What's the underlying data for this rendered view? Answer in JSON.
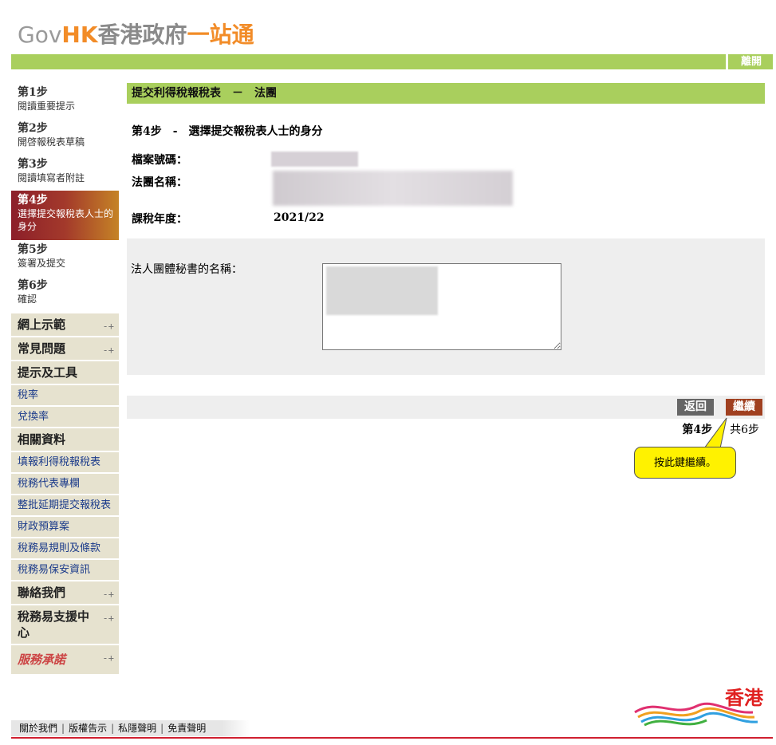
{
  "logo": {
    "gov": "Gov",
    "hk": "HK",
    "cn_gray": "香港政府",
    "cn_orange": "一站通"
  },
  "topbar": {
    "logout": "離開"
  },
  "steps": [
    {
      "num": "第1步",
      "desc": "閱讀重要提示"
    },
    {
      "num": "第2步",
      "desc": "開啓報稅表草稿"
    },
    {
      "num": "第3步",
      "desc": "閱讀填寫者附註"
    },
    {
      "num": "第4步",
      "desc": "選擇提交報稅表人士的身分"
    },
    {
      "num": "第5步",
      "desc": "簽署及提交"
    },
    {
      "num": "第6步",
      "desc": "確認"
    }
  ],
  "menu": {
    "demo": "網上示範",
    "faq": "常見問題",
    "tips": "提示及工具",
    "tax_rate": "稅率",
    "exchange": "兌換率",
    "related": "相關資料",
    "related_items": [
      "填報利得稅報稅表",
      "稅務代表專欄",
      "整批延期提交報稅表",
      "財政預算案",
      "稅務易規則及條款",
      "稅務易保安資訊"
    ],
    "contact": "聯絡我們",
    "support": "稅務易支援中心",
    "pledge": "服務承諾",
    "plus": "-+"
  },
  "main": {
    "title": "提交利得稅報稅表　－　法團",
    "step_title": "第4步　-　選擇提交報稅表人士的身分",
    "file_no_label": "檔案號碼：",
    "corp_name_label": "法團名稱：",
    "year_label": "課稅年度：",
    "year_value": "2021/22",
    "secretary_label": "法人團體秘書的名稱："
  },
  "buttons": {
    "back": "返回",
    "next": "繼續"
  },
  "pager": {
    "current": "第4步",
    "total": "共6步"
  },
  "tooltip": "按此鍵繼續。",
  "footer": {
    "about": "關於我們",
    "copyright": "版權告示",
    "privacy": "私隱聲明",
    "disclaimer": "免責聲明"
  },
  "hk_brand": "香港",
  "colors": {
    "green": "#a9cf5d",
    "menu_bg": "#e6e2cf",
    "next_btn": "#a04020",
    "back_btn": "#666666",
    "tooltip": "#fff200"
  }
}
